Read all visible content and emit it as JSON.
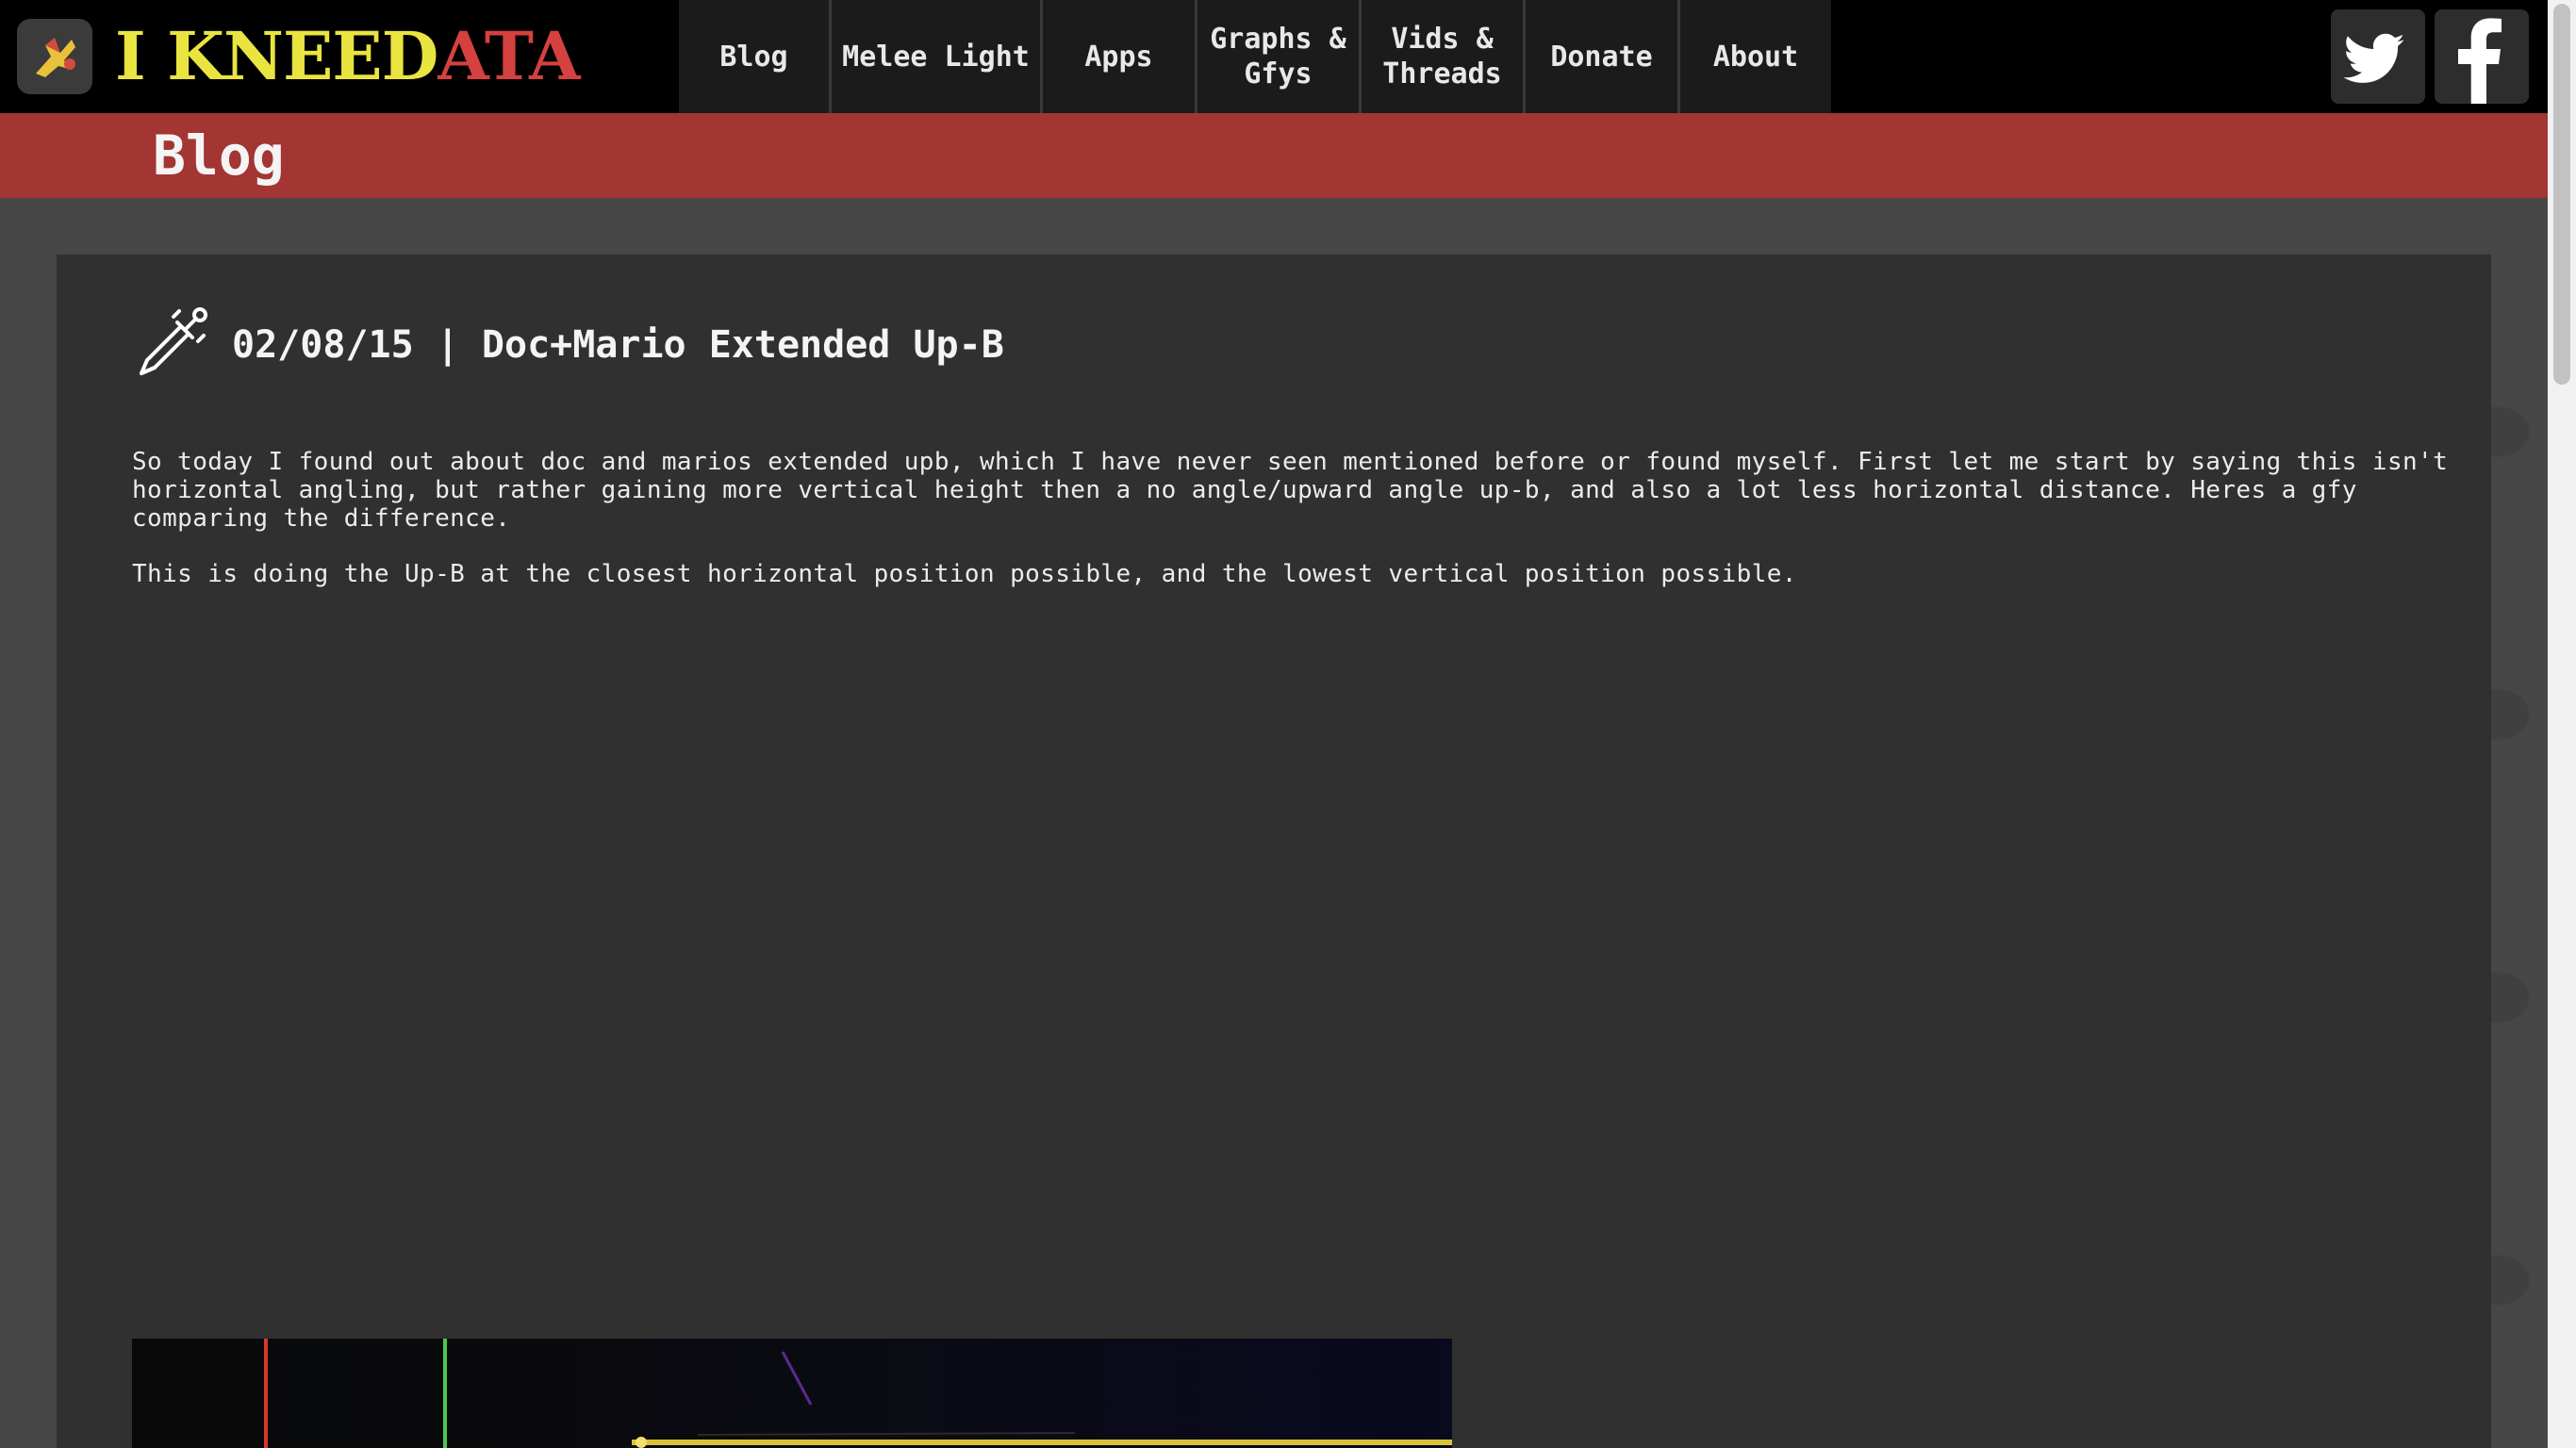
{
  "brand": {
    "part1": "I KNEED",
    "part2": "ATA"
  },
  "nav": {
    "items": [
      "Blog",
      "Melee Light",
      "Apps",
      "Graphs & Gfys",
      "Vids & Threads",
      "Donate",
      "About"
    ]
  },
  "social": {
    "icons": [
      "twitter-icon",
      "facebook-icon"
    ]
  },
  "section": {
    "title": "Blog"
  },
  "post": {
    "icon": "sword-icon",
    "title": "02/08/15 | Doc+Mario Extended Up-B",
    "paragraphs": [
      "So today I found out about doc and marios extended upb, which I have never seen mentioned before or found myself. First let me start by saying this isn't horizontal angling, but rather gaining more vertical height then a no angle/upward angle up-b, and also a lot less horizontal distance. Heres a gfy comparing the difference.",
      "This is doing the Up-B at the closest horizontal position possible, and the lowest vertical position possible."
    ]
  },
  "colors": {
    "topbar": "#000000",
    "accent_red": "#a33533",
    "brand_yellow": "#e9e43f",
    "brand_red": "#d4413e",
    "panel": "#2c2c2c",
    "background": "#474747"
  }
}
